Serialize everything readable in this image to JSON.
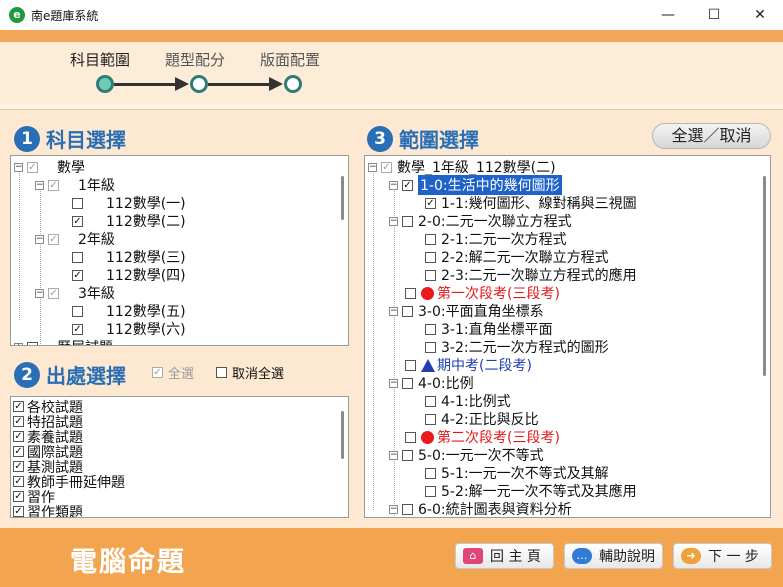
{
  "window": {
    "title": "南e題庫系統",
    "icon": "e",
    "min": "—",
    "max": "☐",
    "close": "✕"
  },
  "wizard": {
    "steps": [
      "科目範圍",
      "題型配分",
      "版面配置"
    ]
  },
  "subject": {
    "num": "1",
    "title": "科目選擇",
    "tree": [
      {
        "label": "數學",
        "checked": "✓"
      },
      {
        "label": "1年級",
        "checked": "✓"
      },
      {
        "label": "112數學(一)",
        "checked": ""
      },
      {
        "label": "112數學(二)",
        "checked": "✓"
      },
      {
        "label": "2年級",
        "checked": "✓"
      },
      {
        "label": "112數學(三)",
        "checked": ""
      },
      {
        "label": "112數學(四)",
        "checked": "✓"
      },
      {
        "label": "3年級",
        "checked": "✓"
      },
      {
        "label": "112數學(五)",
        "checked": ""
      },
      {
        "label": "112數學(六)",
        "checked": "✓"
      },
      {
        "label": "歷屆試題",
        "checked": ""
      }
    ]
  },
  "source": {
    "num": "2",
    "title": "出處選擇",
    "select_all": "全選",
    "deselect_all": "取消全選",
    "items": [
      "各校試題",
      "特招試題",
      "素養試題",
      "國際試題",
      "基測試題",
      "教師手冊延伸題",
      "習作",
      "習作類題"
    ]
  },
  "range": {
    "num": "3",
    "title": "範圍選擇",
    "toggle_button": "全選／取消",
    "tree": [
      {
        "label": "數學_1年級_112數學(二)"
      },
      {
        "label": "1-0:生活中的幾何圖形"
      },
      {
        "label": "1-1:幾何圖形、線對稱與三視圖"
      },
      {
        "label": "2-0:二元一次聯立方程式"
      },
      {
        "label": "2-1:二元一次方程式"
      },
      {
        "label": "2-2:解二元一次聯立方程式"
      },
      {
        "label": "2-3:二元一次聯立方程式的應用"
      },
      {
        "label": "第一次段考(三段考)"
      },
      {
        "label": "3-0:平面直角坐標系"
      },
      {
        "label": "3-1:直角坐標平面"
      },
      {
        "label": "3-2:二元一次方程式的圖形"
      },
      {
        "label": "期中考(二段考)"
      },
      {
        "label": "4-0:比例"
      },
      {
        "label": "4-1:比例式"
      },
      {
        "label": "4-2:正比與反比"
      },
      {
        "label": "第二次段考(三段考)"
      },
      {
        "label": "5-0:一元一次不等式"
      },
      {
        "label": "5-1:一元一次不等式及其解"
      },
      {
        "label": "5-2:解一元一次不等式及其應用"
      },
      {
        "label": "6-0:統計圖表與資料分析"
      }
    ]
  },
  "footer": {
    "title": "電腦命題",
    "home": "回 主 頁",
    "help": "輔助說明",
    "next": "下 一 步"
  },
  "colors": {
    "accent": "#2a6fb5",
    "orange": "#f2a44f",
    "selection": "#1f62c8",
    "exam_red": "#e01a1a",
    "exam_blue": "#1f3fb0"
  }
}
